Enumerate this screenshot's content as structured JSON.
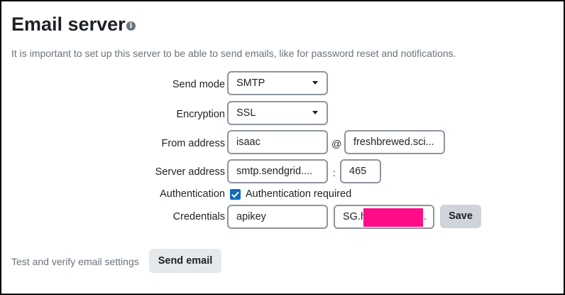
{
  "page": {
    "title": "Email server",
    "info_icon": "info-icon",
    "description": "It is important to set up this server to be able to send emails, like for password reset and notifications."
  },
  "form": {
    "send_mode": {
      "label": "Send mode",
      "value": "SMTP"
    },
    "encryption": {
      "label": "Encryption",
      "value": "SSL"
    },
    "from_address": {
      "label": "From address",
      "user": "isaac",
      "at": "@",
      "domain": "freshbrewed.sci..."
    },
    "server_address": {
      "label": "Server address",
      "host": "smtp.sendgrid....",
      "colon": ":",
      "port": "465"
    },
    "authentication": {
      "label": "Authentication",
      "checkbox_label": "Authentication required",
      "checked": true
    },
    "credentials": {
      "label": "Credentials",
      "username": "apikey",
      "password_visible_prefix": "SG.h",
      "password_suffix": "."
    },
    "save_label": "Save"
  },
  "test": {
    "label": "Test and verify email settings",
    "button_label": "Send email"
  },
  "colors": {
    "accent": "#0f6cbf",
    "redaction": "#ff0d86",
    "button_bg": "#ced4da"
  }
}
